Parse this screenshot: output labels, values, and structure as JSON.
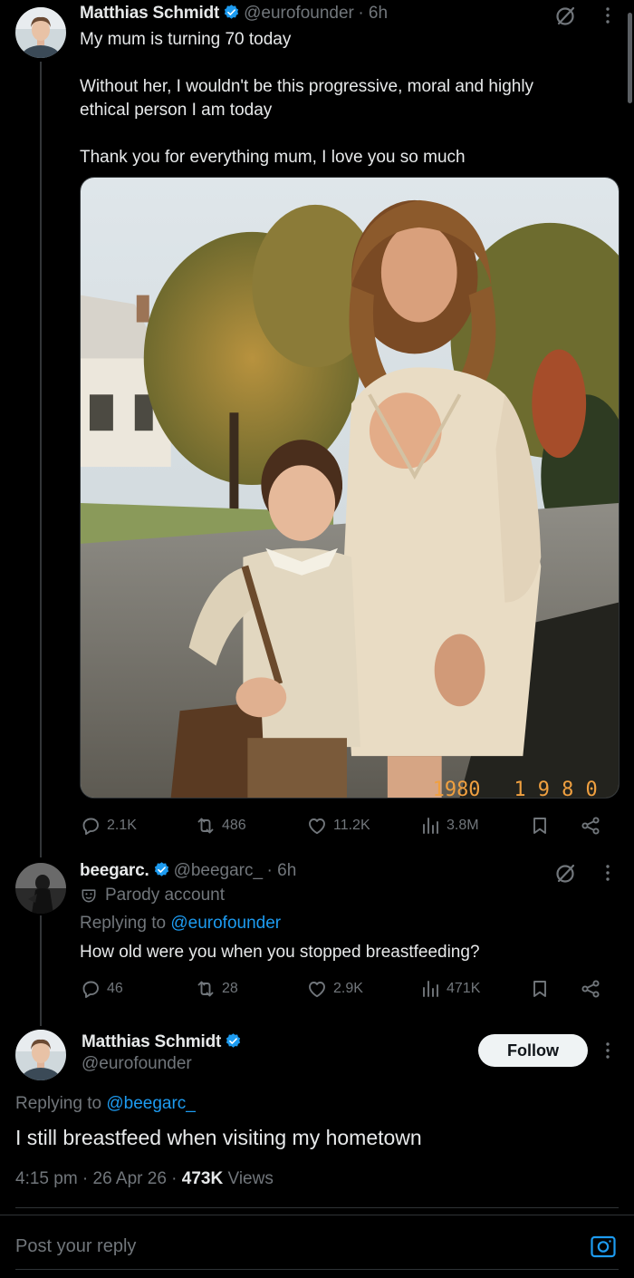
{
  "post1": {
    "name": "Matthias Schmidt",
    "handle": "@eurofounder",
    "time": "· 6h",
    "lines": [
      "My mum is turning 70 today",
      "Without her, I wouldn't be this progressive, moral and highly",
      "ethical person I am today",
      "Thank you for everything mum, I love you so much"
    ],
    "stats": {
      "replies": "2.1K",
      "reposts": "486",
      "likes": "11.2K",
      "views": "3.8M"
    },
    "photo_datestamp": "1980"
  },
  "post2": {
    "name": "beegarc.",
    "handle": "@beegarc_",
    "time": "· 6h",
    "parody": "Parody account",
    "replying_prefix": "Replying to",
    "replying_to": "@eurofounder",
    "text": "How old were you when you stopped breastfeeding?",
    "stats": {
      "replies": "46",
      "reposts": "28",
      "likes": "2.9K",
      "views": "471K"
    }
  },
  "post3": {
    "name": "Matthias Schmidt",
    "handle": "@eurofounder",
    "follow_label": "Follow",
    "replying_prefix": "Replying to",
    "replying_to": "@beegarc_",
    "text": "I still breastfeed when visiting my hometown",
    "timestamp": "4:15 pm · 26 Apr 26 ·",
    "views_count": "473K",
    "views_label": "Views"
  },
  "composer": {
    "placeholder": "Post your reply"
  },
  "colors": {
    "accent": "#1d9bf0",
    "muted": "#71767b",
    "text": "#e7e9ea",
    "background": "#000000"
  },
  "icons": [
    "verified-badge-icon",
    "grok-icon",
    "more-icon",
    "reply-icon",
    "repost-icon",
    "like-icon",
    "views-icon",
    "bookmark-icon",
    "share-icon",
    "camera-icon",
    "parody-mask-icon"
  ]
}
